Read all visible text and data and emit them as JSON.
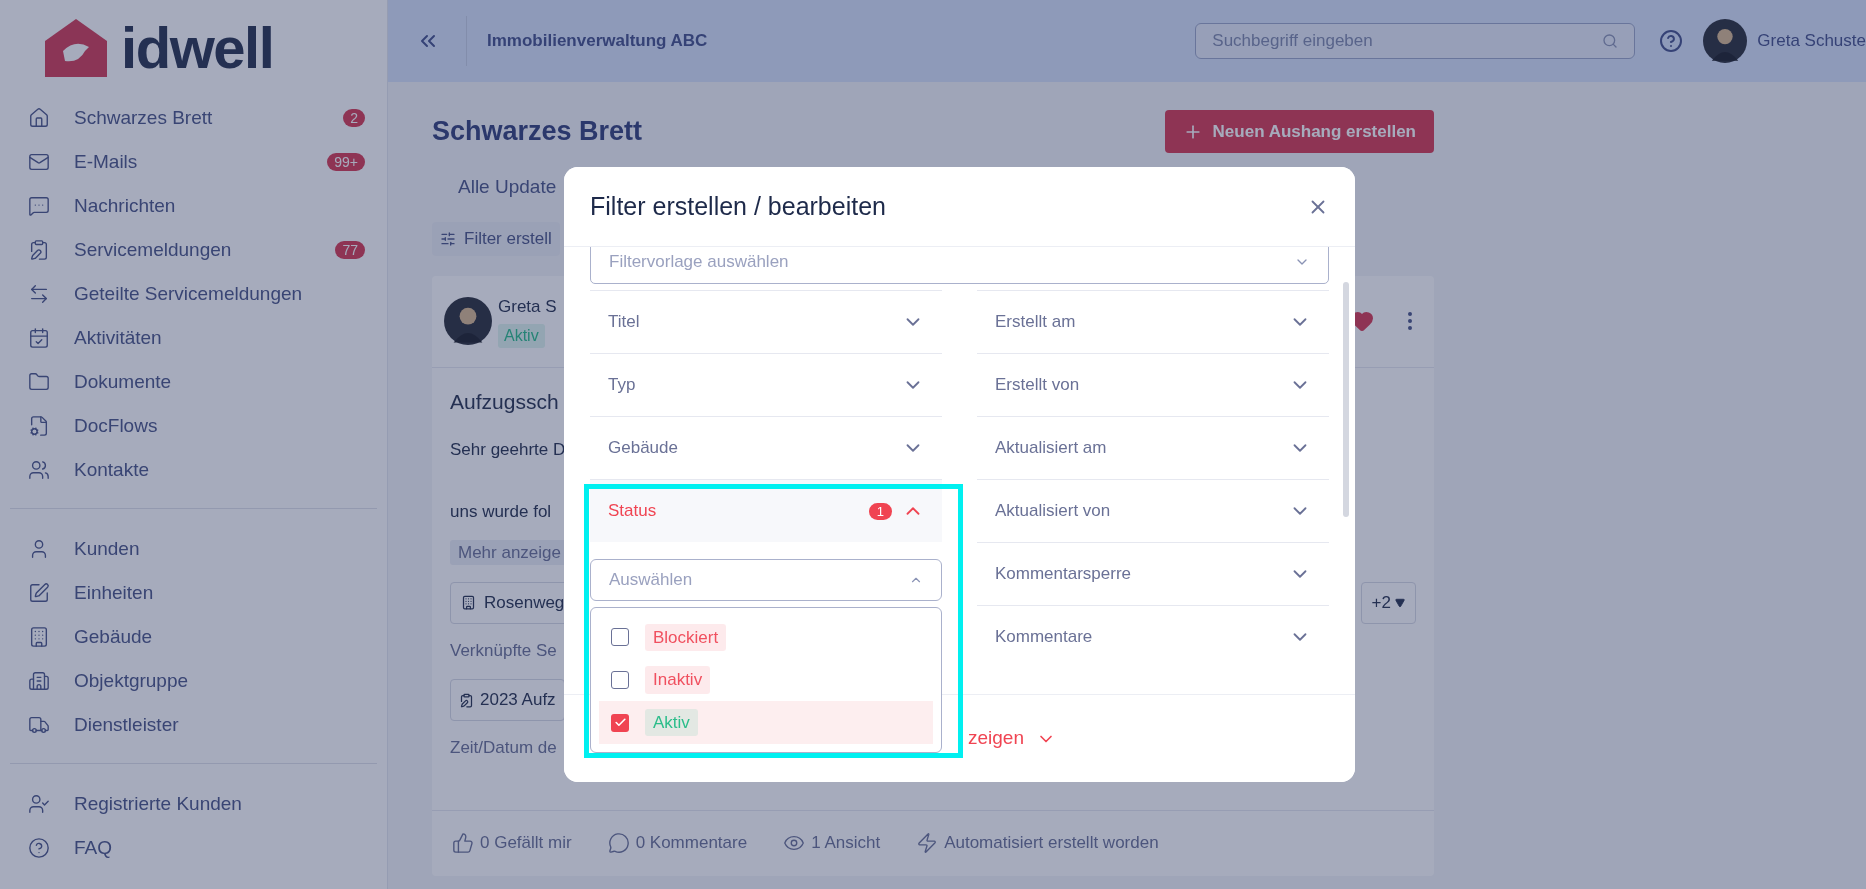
{
  "sidebar": {
    "logo_text": "idwell",
    "groups": [
      [
        {
          "label": "Schwarzes Brett",
          "badge": "2"
        },
        {
          "label": "E-Mails",
          "badge": "99+"
        },
        {
          "label": "Nachrichten"
        },
        {
          "label": "Servicemeldungen",
          "badge": "77"
        },
        {
          "label": "Geteilte Servicemeldungen"
        },
        {
          "label": "Aktivitäten"
        },
        {
          "label": "Dokumente"
        },
        {
          "label": "DocFlows"
        },
        {
          "label": "Kontakte"
        }
      ],
      [
        {
          "label": "Kunden"
        },
        {
          "label": "Einheiten"
        },
        {
          "label": "Gebäude"
        },
        {
          "label": "Objektgruppe"
        },
        {
          "label": "Dienstleister"
        }
      ],
      [
        {
          "label": "Registrierte Kunden"
        },
        {
          "label": "FAQ"
        }
      ]
    ]
  },
  "header": {
    "org": "Immobilienverwaltung ABC",
    "search": {
      "placeholder": "Suchbegriff eingeben"
    },
    "user": "Greta Schuste"
  },
  "page": {
    "title": "Schwarzes Brett",
    "new_button": "Neuen Aushang erstellen",
    "tab": "Alle Update",
    "filter_button": "Filter erstell",
    "card": {
      "author": "Greta S",
      "status": "Aktiv",
      "title": "Aufzugssch",
      "line_1": "Sehr geehrte D",
      "line_2": "uns wurde fol",
      "more": "Mehr anzeige",
      "building_chip": "Rosenweg",
      "extra_chip": "+2",
      "linked_label": "Verknüpfte Se",
      "linked_chip": "2023 Aufz",
      "time_label": "Zeit/Datum de",
      "stats": [
        "0 Gefällt mir",
        "0 Kommentare",
        "1 Ansicht",
        "Automatisiert erstellt worden"
      ]
    }
  },
  "modal": {
    "title": "Filter erstellen / bearbeiten",
    "template_placeholder": "Filtervorlage auswählen",
    "left_filters": [
      {
        "label": "Titel",
        "expanded": false
      },
      {
        "label": "Typ",
        "expanded": false
      },
      {
        "label": "Gebäude",
        "expanded": false
      },
      {
        "label": "Status",
        "expanded": true,
        "count": "1"
      }
    ],
    "status_select": {
      "placeholder": "Auswählen",
      "options": [
        {
          "label": "Blockiert",
          "checked": false,
          "color": "#f0505f"
        },
        {
          "label": "Inaktiv",
          "checked": false,
          "color": "#f0505f"
        },
        {
          "label": "Aktiv",
          "checked": true,
          "color": "#2bbd8a"
        }
      ]
    },
    "right_filters": [
      {
        "label": "Erstellt am",
        "expanded": false
      },
      {
        "label": "Erstellt von",
        "expanded": false
      },
      {
        "label": "Aktualisiert am",
        "expanded": false
      },
      {
        "label": "Aktualisiert von",
        "expanded": false
      },
      {
        "label": "Kommentarsperre",
        "expanded": false
      },
      {
        "label": "Kommentare",
        "expanded": false
      }
    ],
    "footer_link": "zeigen"
  }
}
